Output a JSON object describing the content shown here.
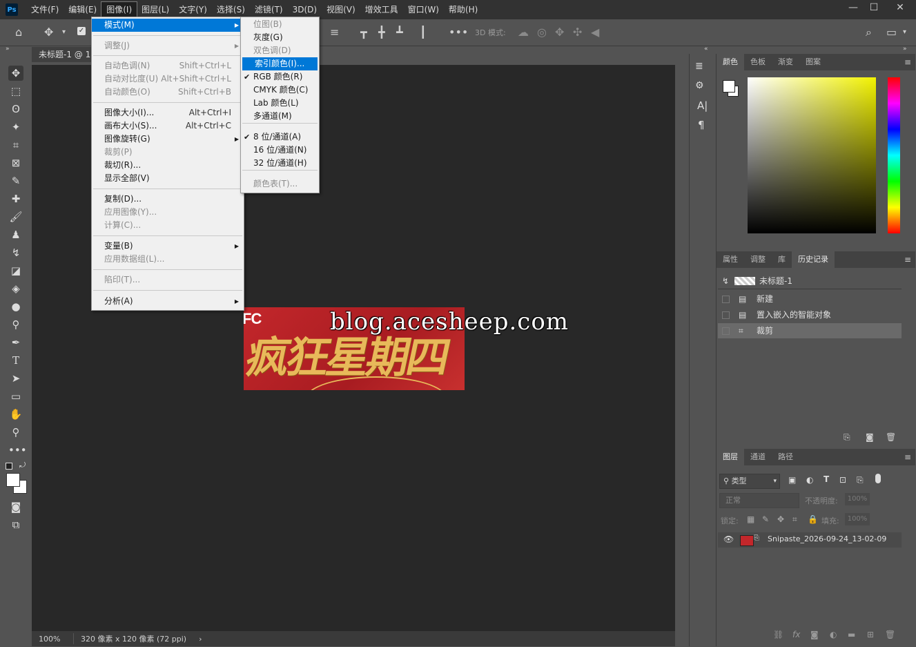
{
  "menubar": {
    "logo": "Ps",
    "items": [
      "文件(F)",
      "编辑(E)",
      "图像(I)",
      "图层(L)",
      "文字(Y)",
      "选择(S)",
      "滤镜(T)",
      "3D(D)",
      "视图(V)",
      "增效工具",
      "窗口(W)",
      "帮助(H)"
    ],
    "active_index": 2,
    "win_min": "—",
    "win_max": "☐",
    "win_close": "✕"
  },
  "options": {
    "mode_3d_label": "3D 模式:"
  },
  "document": {
    "tab_title": "未标题-1 @ 10",
    "banner_brand": "FC",
    "banner_text": "疯狂星期四",
    "watermark": "blog.acesheep.com",
    "status_zoom": "100%",
    "status_info": "320 像素 x 120 像素 (72 ppi)",
    "status_arrow": "›"
  },
  "image_menu": {
    "items": [
      {
        "label": "模式(M)",
        "shortcut": "",
        "submenu": true,
        "disabled": false,
        "highlight": true
      },
      {
        "label": "调整(J)",
        "shortcut": "",
        "submenu": true,
        "disabled": true
      },
      {
        "label": "自动色调(N)",
        "shortcut": "Shift+Ctrl+L",
        "disabled": true
      },
      {
        "label": "自动对比度(U)",
        "shortcut": "Alt+Shift+Ctrl+L",
        "disabled": true
      },
      {
        "label": "自动颜色(O)",
        "shortcut": "Shift+Ctrl+B",
        "disabled": true
      },
      {
        "label": "图像大小(I)...",
        "shortcut": "Alt+Ctrl+I",
        "disabled": false
      },
      {
        "label": "画布大小(S)...",
        "shortcut": "Alt+Ctrl+C",
        "disabled": false
      },
      {
        "label": "图像旋转(G)",
        "shortcut": "",
        "submenu": true,
        "disabled": false
      },
      {
        "label": "裁剪(P)",
        "shortcut": "",
        "disabled": true
      },
      {
        "label": "裁切(R)...",
        "shortcut": "",
        "disabled": false
      },
      {
        "label": "显示全部(V)",
        "shortcut": "",
        "disabled": false
      },
      {
        "label": "复制(D)...",
        "shortcut": "",
        "disabled": false
      },
      {
        "label": "应用图像(Y)...",
        "shortcut": "",
        "disabled": true
      },
      {
        "label": "计算(C)...",
        "shortcut": "",
        "disabled": true
      },
      {
        "label": "变量(B)",
        "shortcut": "",
        "submenu": true,
        "disabled": false
      },
      {
        "label": "应用数据组(L)...",
        "shortcut": "",
        "disabled": true
      },
      {
        "label": "陷印(T)...",
        "shortcut": "",
        "disabled": true
      },
      {
        "label": "分析(A)",
        "shortcut": "",
        "submenu": true,
        "disabled": false
      }
    ]
  },
  "mode_menu": {
    "items": [
      {
        "label": "位图(B)",
        "disabled": true
      },
      {
        "label": "灰度(G)",
        "disabled": false
      },
      {
        "label": "双色调(D)",
        "disabled": true
      },
      {
        "label": "索引颜色(I)...",
        "disabled": false,
        "highlight": true
      },
      {
        "label": "RGB 颜色(R)",
        "checked": true
      },
      {
        "label": "CMYK 颜色(C)"
      },
      {
        "label": "Lab 颜色(L)"
      },
      {
        "label": "多通道(M)"
      },
      {
        "label": "8 位/通道(A)",
        "checked": true
      },
      {
        "label": "16 位/通道(N)"
      },
      {
        "label": "32 位/通道(H)"
      },
      {
        "label": "颜色表(T)...",
        "disabled": true
      }
    ],
    "check": "✔"
  },
  "color_panel": {
    "tabs": [
      "颜色",
      "色板",
      "渐变",
      "图案"
    ],
    "active": 0
  },
  "history_panel": {
    "tabs": [
      "属性",
      "调整",
      "库",
      "历史记录"
    ],
    "active": 3,
    "snapshot": "未标题-1",
    "steps": [
      "新建",
      "置入嵌入的智能对象",
      "裁剪"
    ]
  },
  "layers_panel": {
    "tabs": [
      "图层",
      "通道",
      "路径"
    ],
    "active": 0,
    "filter_label": "类型",
    "blend_mode": "正常",
    "opacity_label": "不透明度:",
    "opacity_value": "100%",
    "lock_label": "锁定:",
    "fill_label": "填充:",
    "fill_value": "100%",
    "layer_name": "Snipaste_2026-09-24_13-02-09"
  },
  "colors": {
    "menubar_bg": "#323232",
    "panel_bg": "#535353",
    "canvas_bg": "#282828",
    "menu_highlight": "#0078d7",
    "banner_red": "#c3272b",
    "banner_gold": "#e8b95a"
  }
}
